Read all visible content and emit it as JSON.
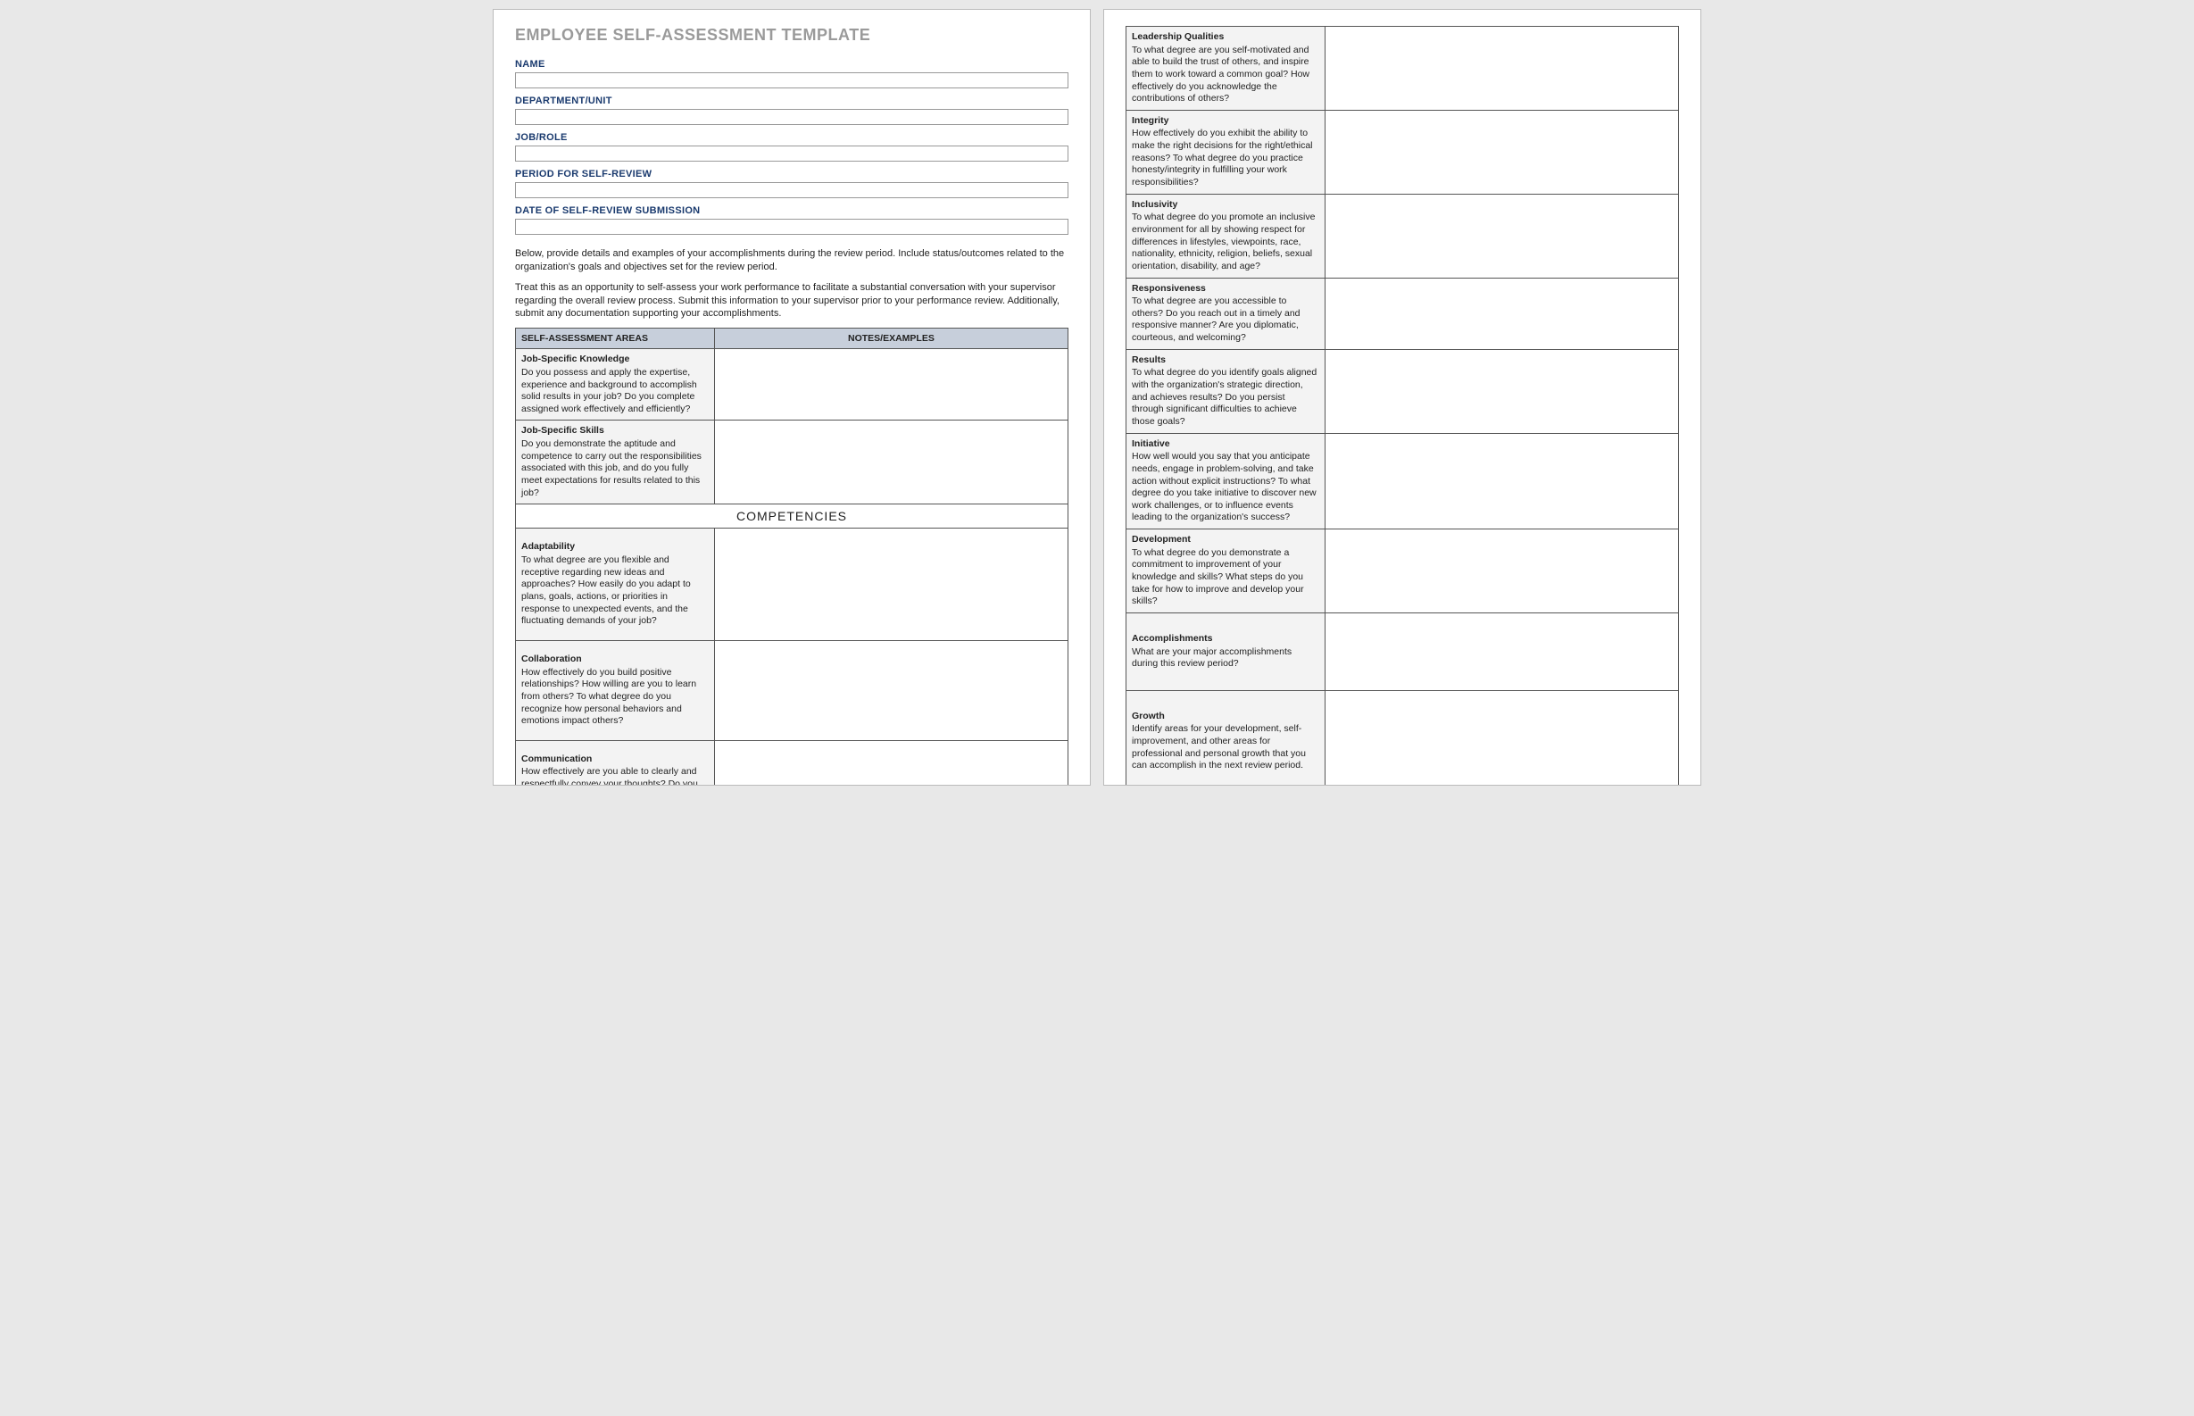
{
  "title": "EMPLOYEE SELF-ASSESSMENT TEMPLATE",
  "fields": {
    "name": {
      "label": "NAME",
      "value": ""
    },
    "department": {
      "label": "DEPARTMENT/UNIT",
      "value": ""
    },
    "job": {
      "label": "JOB/ROLE",
      "value": ""
    },
    "period": {
      "label": "PERIOD FOR SELF-REVIEW",
      "value": ""
    },
    "submission_date": {
      "label": "DATE OF SELF-REVIEW SUBMISSION",
      "value": ""
    }
  },
  "instructions": {
    "p1": "Below, provide details and examples of your accomplishments during the review period. Include status/outcomes related to the organization's goals and objectives set for the review period.",
    "p2": "Treat this as an opportunity to self-assess your work performance to facilitate a substantial conversation with your supervisor regarding the overall review process. Submit this information to your supervisor prior to your performance review. Additionally, submit any documentation supporting your accomplishments."
  },
  "table_headers": {
    "areas": "SELF-ASSESSMENT AREAS",
    "notes": "NOTES/EXAMPLES"
  },
  "competencies_label": "COMPETENCIES",
  "rows_page1": [
    {
      "title": "Job-Specific Knowledge",
      "desc": "Do you possess and apply the expertise, experience and background to accomplish solid results in your job? Do you complete assigned work effectively and efficiently?",
      "notes": ""
    },
    {
      "title": "Job-Specific Skills",
      "desc": "Do you demonstrate the aptitude and competence to carry out the responsibilities associated with this job, and do you fully meet expectations for results related to this job?",
      "notes": ""
    }
  ],
  "rows_comp_page1": [
    {
      "title": "Adaptability",
      "desc": "To what degree are you flexible and receptive regarding new ideas and approaches? How easily do you adapt to plans, goals, actions, or priorities in response to unexpected events, and the fluctuating demands of your job?",
      "notes": ""
    },
    {
      "title": "Collaboration",
      "desc": "How effectively do you build positive relationships? How willing are you to learn from others? To what degree do you recognize how personal behaviors and emotions impact others?",
      "notes": ""
    },
    {
      "title": "Communication",
      "desc": "How effectively are you able to clearly and respectfully convey your thoughts? Do you demonstrate effective listening skills?",
      "notes": ""
    }
  ],
  "rows_page2": [
    {
      "title": "Leadership Qualities",
      "desc": "To what degree are you self-motivated and able to build the trust of others, and inspire them to work toward a common goal? How effectively do you acknowledge the contributions of others?",
      "notes": ""
    },
    {
      "title": "Integrity",
      "desc": "How effectively do you exhibit the ability to make the right decisions for the right/ethical reasons? To what degree do you practice honesty/integrity in fulfilling your work responsibilities?",
      "notes": ""
    },
    {
      "title": "Inclusivity",
      "desc": "To what degree do you promote an inclusive environment for all by showing respect for differences in lifestyles, viewpoints, race, nationality, ethnicity, religion, beliefs, sexual orientation, disability, and age?",
      "notes": ""
    },
    {
      "title": "  Responsiveness",
      "desc": "To what degree are you accessible to others? Do you reach out in a timely and responsive manner? Are you diplomatic, courteous, and welcoming?",
      "notes": ""
    },
    {
      "title": "Results",
      "desc": "To what degree do you identify goals aligned with the organization's strategic direction, and achieves results? Do you persist through significant difficulties to achieve those goals?",
      "notes": ""
    },
    {
      "title": "Initiative",
      "desc": "How well would you say that you anticipate needs, engage in problem-solving, and take action without explicit instructions? To what degree do you take initiative to discover new work challenges, or to influence events leading to the organization's success?",
      "notes": ""
    },
    {
      "title": "Development",
      "desc": "To what degree do you demonstrate a commitment to improvement of your knowledge and skills? What steps do you take for how to improve and develop your skills?",
      "notes": ""
    },
    {
      "title": "Accomplishments",
      "desc": "What are your major accomplishments during this review period?",
      "notes": ""
    },
    {
      "title": "Growth",
      "desc": "Identify areas for your development, self-improvement, and other areas for professional and personal growth that you can accomplish in the next review period.",
      "notes": ""
    }
  ]
}
